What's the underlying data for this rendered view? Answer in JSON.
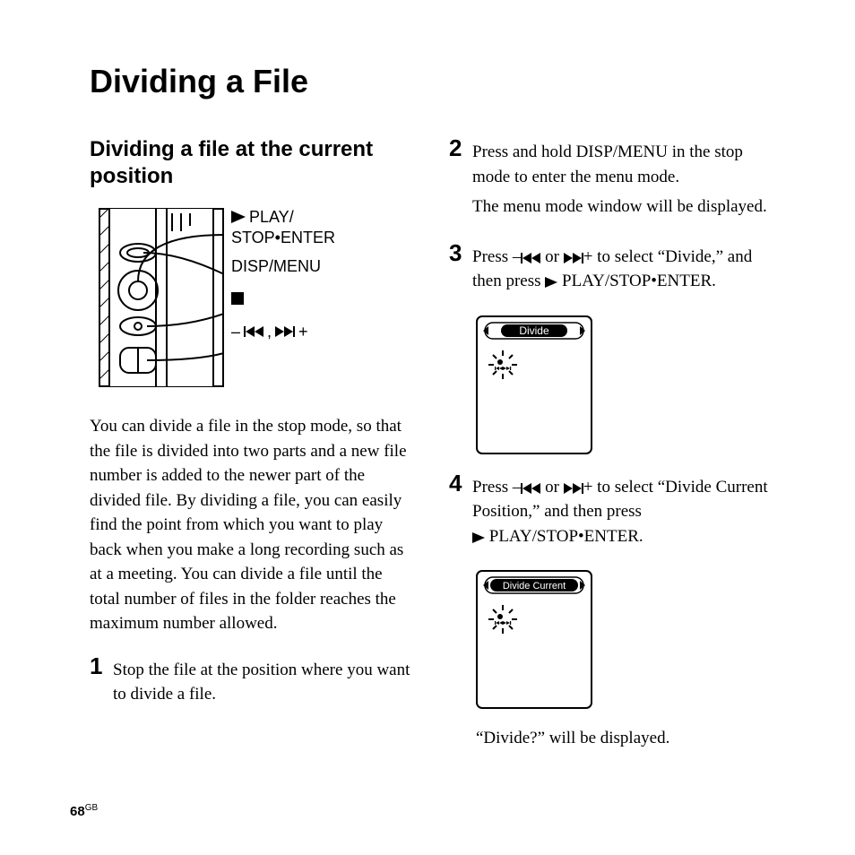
{
  "title": "Dividing a File",
  "subtitle": "Dividing a file at the current position",
  "callouts": {
    "play": "PLAY/",
    "stop_enter": "STOP•ENTER",
    "disp_menu": "DISP/MENU",
    "seek_sep": ","
  },
  "intro": "You can divide a file in the stop mode, so that the file is divided into two parts and a new file number is added to the newer part of the divided file. By dividing a file, you can easily find the point from which you want to play back when you make a long recording such as at a meeting. You can divide a file until the total number of files in the folder reaches the maximum number allowed.",
  "steps": {
    "s1": {
      "num": "1",
      "text": "Stop the file at the position where you want to divide a file."
    },
    "s2": {
      "num": "2",
      "text1": "Press and hold DISP/MENU in the stop mode to enter the menu mode.",
      "text2": "The menu mode window will be displayed."
    },
    "s3": {
      "num": "3",
      "pre": "Press –",
      "mid": " or ",
      "post1": "+ to select “Divide,” and then press ",
      "post2": " PLAY/STOP•ENTER."
    },
    "s4": {
      "num": "4",
      "pre": "Press –",
      "mid": " or ",
      "post1": "+ to select “Divide Current Position,” and then press",
      "post2": " PLAY/STOP•ENTER."
    }
  },
  "screens": {
    "divide": "Divide",
    "divide_current": "Divide Current"
  },
  "closing": "“Divide?” will be displayed.",
  "page_number": "68",
  "page_suffix": "GB"
}
